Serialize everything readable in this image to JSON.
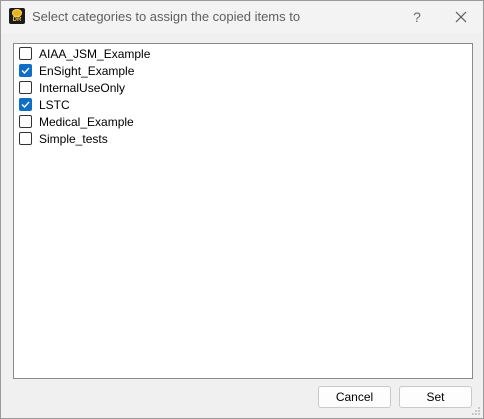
{
  "window": {
    "title": "Select categories to assign the copied items to",
    "app_icon_text": "DR",
    "help_label": "?"
  },
  "categories": [
    {
      "label": "AIAA_JSM_Example",
      "checked": false
    },
    {
      "label": "EnSight_Example",
      "checked": true
    },
    {
      "label": "InternalUseOnly",
      "checked": false
    },
    {
      "label": "LSTC",
      "checked": true
    },
    {
      "label": "Medical_Example",
      "checked": false
    },
    {
      "label": "Simple_tests",
      "checked": false
    }
  ],
  "buttons": {
    "cancel_label": "Cancel",
    "set_label": "Set"
  },
  "colors": {
    "accent": "#0f6fc6"
  }
}
